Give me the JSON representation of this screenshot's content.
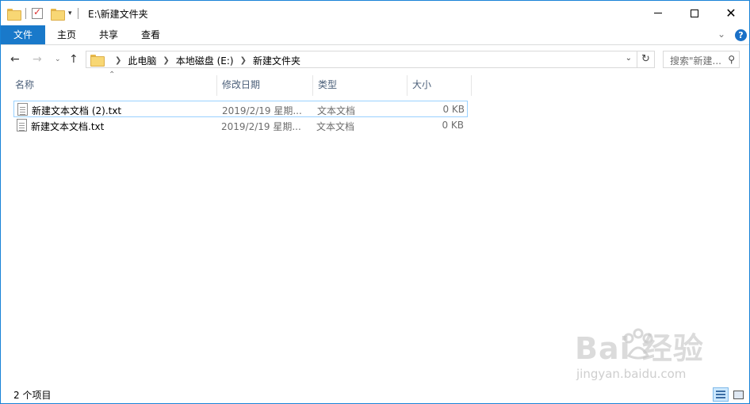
{
  "window": {
    "title": "E:\\新建文件夹"
  },
  "ribbon": {
    "tabs": [
      {
        "label": "文件",
        "active": true
      },
      {
        "label": "主页"
      },
      {
        "label": "共享"
      },
      {
        "label": "查看"
      }
    ],
    "help_label": "?"
  },
  "address": {
    "breadcrumbs": [
      "此电脑",
      "本地磁盘 (E:)",
      "新建文件夹"
    ],
    "search_placeholder": "搜索\"新建..."
  },
  "columns": [
    {
      "label": "名称"
    },
    {
      "label": "修改日期"
    },
    {
      "label": "类型"
    },
    {
      "label": "大小"
    }
  ],
  "files": [
    {
      "name": "新建文本文档 (2).txt",
      "modified": "2019/2/19 星期...",
      "type": "文本文档",
      "size": "0 KB",
      "selected": true
    },
    {
      "name": "新建文本文档.txt",
      "modified": "2019/2/19 星期...",
      "type": "文本文档",
      "size": "0 KB",
      "selected": false
    }
  ],
  "status": {
    "item_count": "2 个项目"
  },
  "watermark": {
    "main": "Bai  经验",
    "sub": "jingyan.baidu.com"
  },
  "colors": {
    "accent": "#1979ca",
    "selection_border": "#99d1ff",
    "column_header_text": "#4c607a"
  }
}
